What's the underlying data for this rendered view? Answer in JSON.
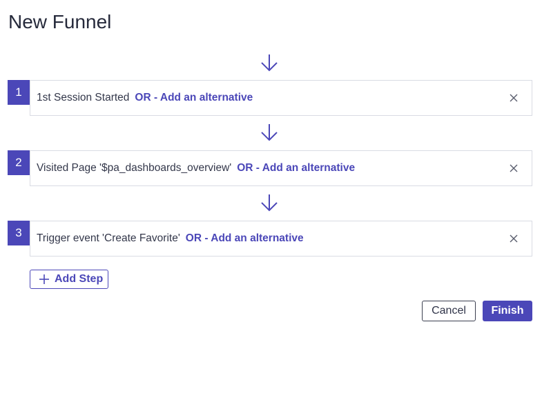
{
  "page": {
    "title": "New Funnel"
  },
  "steps": [
    {
      "number": "1",
      "label": "1st Session Started",
      "or_link": "OR - Add an alternative"
    },
    {
      "number": "2",
      "label": "Visited Page '$pa_dashboards_overview'",
      "or_link": "OR - Add an alternative"
    },
    {
      "number": "3",
      "label": "Trigger event 'Create Favorite'",
      "or_link": "OR - Add an alternative"
    }
  ],
  "actions": {
    "add_step_label": "Add Step",
    "cancel_label": "Cancel",
    "finish_label": "Finish"
  },
  "icons": {
    "arrow": "arrow-down-icon",
    "remove": "close-icon",
    "add": "plus-icon"
  },
  "colors": {
    "accent": "#4b47b8",
    "text": "#33374a",
    "border": "#d9dbe3"
  }
}
